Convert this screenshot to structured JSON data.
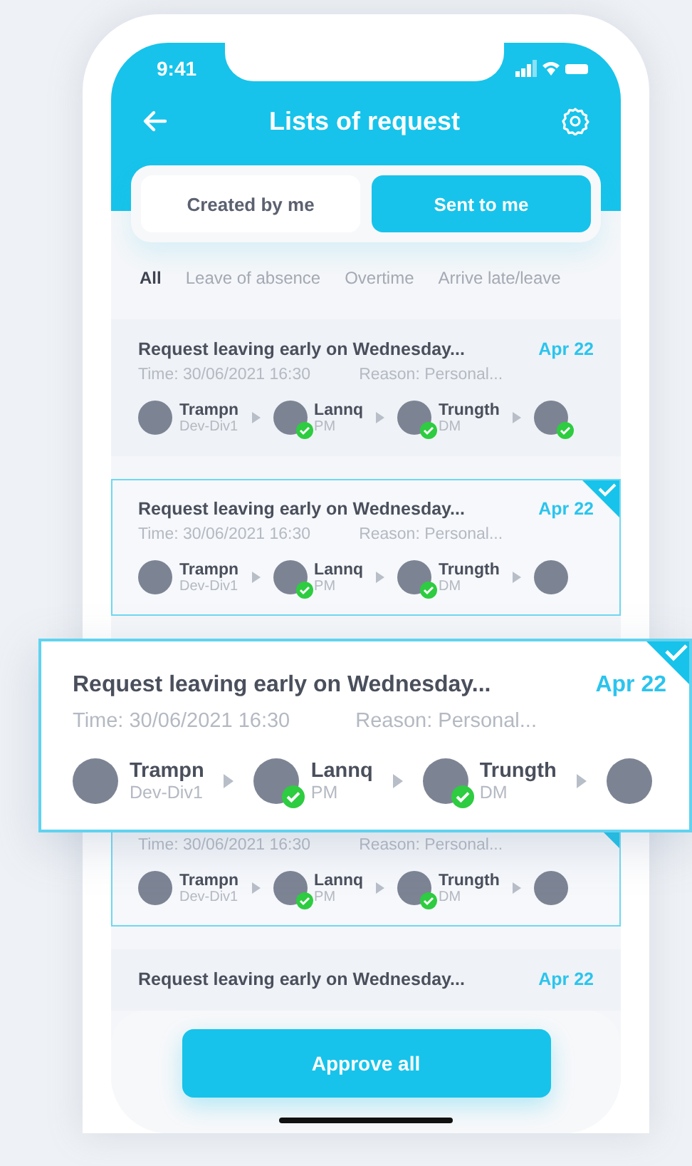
{
  "status_bar": {
    "time": "9:41"
  },
  "header": {
    "title": "Lists of request"
  },
  "segments": [
    {
      "label": "Created by me",
      "selected": false
    },
    {
      "label": "Sent to me",
      "selected": true
    }
  ],
  "filters": [
    {
      "label": "All",
      "selected": true
    },
    {
      "label": "Leave of absence",
      "selected": false
    },
    {
      "label": "Overtime",
      "selected": false
    },
    {
      "label": "Arrive late/leave",
      "selected": false
    }
  ],
  "requests": [
    {
      "title": "Request leaving early on Wednesday...",
      "date": "Apr 22",
      "time": "Time: 30/06/2021 16:30",
      "reason": "Reason: Personal...",
      "selected": false,
      "approvers": [
        {
          "name": "Trampn",
          "role": "Dev-Div1",
          "approved": false
        },
        {
          "name": "Lannq",
          "role": "PM",
          "approved": true
        },
        {
          "name": "Trungth",
          "role": "DM",
          "approved": true
        },
        {
          "approved": true
        }
      ]
    },
    {
      "title": "Request leaving early on Wednesday...",
      "date": "Apr 22",
      "time": "Time: 30/06/2021 16:30",
      "reason": "Reason: Personal...",
      "selected": true,
      "approvers": [
        {
          "name": "Trampn",
          "role": "Dev-Div1",
          "approved": false
        },
        {
          "name": "Lannq",
          "role": "PM",
          "approved": true
        },
        {
          "name": "Trungth",
          "role": "DM",
          "approved": true
        },
        {
          "approved": false
        }
      ]
    },
    {
      "time": "Time: 30/06/2021 16:30",
      "reason": "Reason: Personal...",
      "selected": true,
      "approvers": [
        {
          "name": "Trampn",
          "role": "Dev-Div1",
          "approved": false
        },
        {
          "name": "Lannq",
          "role": "PM",
          "approved": true
        },
        {
          "name": "Trungth",
          "role": "DM",
          "approved": true
        },
        {
          "approved": false
        }
      ]
    },
    {
      "title": "Request leaving early on Wednesday...",
      "date": "Apr 22",
      "selected": false
    }
  ],
  "popout": {
    "title": "Request leaving early on Wednesday...",
    "date": "Apr 22",
    "time": "Time: 30/06/2021 16:30",
    "reason": "Reason: Personal...",
    "selected": true,
    "approvers": [
      {
        "name": "Trampn",
        "role": "Dev-Div1",
        "approved": false
      },
      {
        "name": "Lannq",
        "role": "PM",
        "approved": true
      },
      {
        "name": "Trungth",
        "role": "DM",
        "approved": true
      },
      {
        "approved": false
      }
    ]
  },
  "approve_button": "Approve all"
}
